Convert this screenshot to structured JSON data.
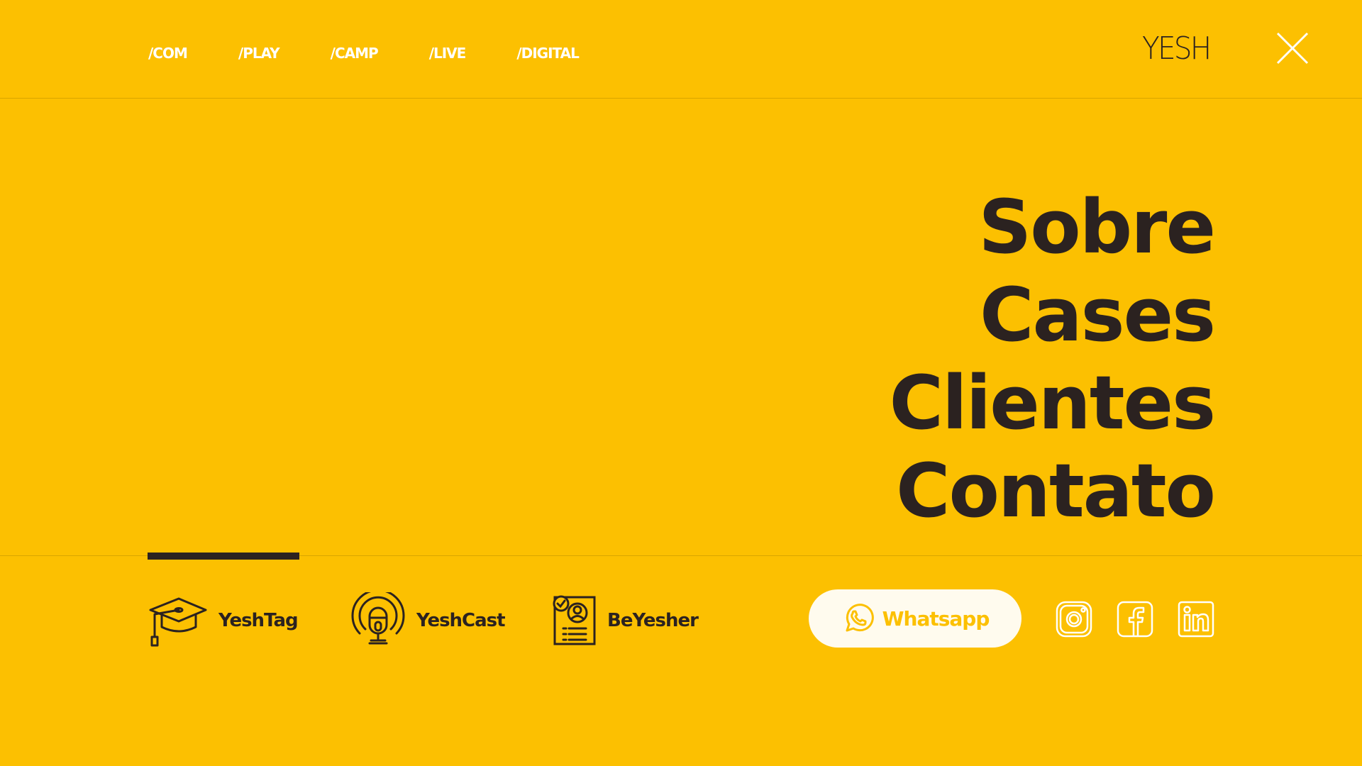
{
  "topnav": {
    "items": [
      "/COM",
      "/PLAY",
      "/CAMP",
      "/LIVE",
      "/DIGITAL"
    ]
  },
  "brand": {
    "logo_text": "YESH"
  },
  "menu": {
    "items": [
      "Sobre",
      "Cases",
      "Clientes",
      "Contato"
    ]
  },
  "products": {
    "items": [
      {
        "label": "YeshTag",
        "icon": "graduation-cap-icon"
      },
      {
        "label": "YeshCast",
        "icon": "podcast-microphone-icon"
      },
      {
        "label": "BeYesher",
        "icon": "profile-document-icon"
      }
    ]
  },
  "whatsapp": {
    "label": "Whatsapp",
    "icon": "whatsapp-icon"
  },
  "social": {
    "items": [
      "instagram-icon",
      "facebook-icon",
      "linkedin-icon"
    ]
  },
  "colors": {
    "background": "#FCC001",
    "text_dark": "#2B2220",
    "white": "#FFFFFF",
    "pill_background": "#FFFBEE"
  }
}
